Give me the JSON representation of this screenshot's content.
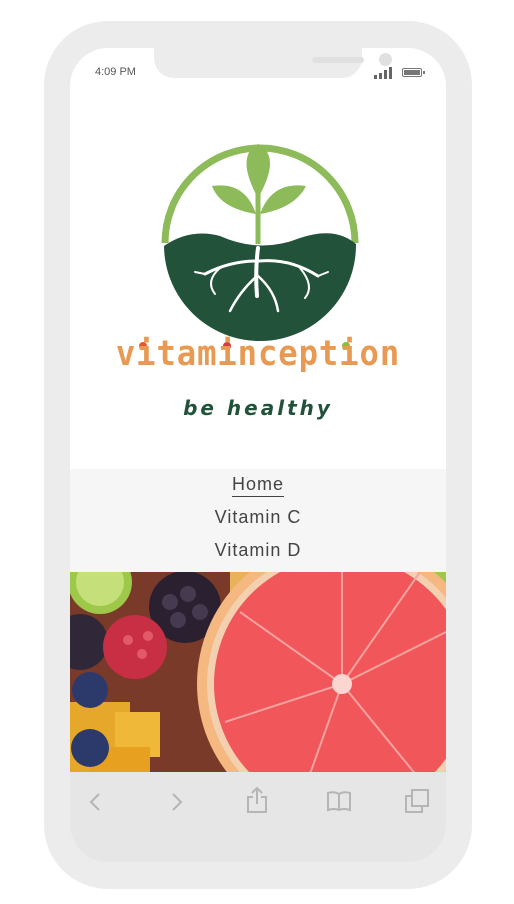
{
  "status_bar": {
    "time": "4:09 PM"
  },
  "brand": {
    "name": "vitaminception",
    "tagline": "be healthy"
  },
  "nav": {
    "items": [
      {
        "label": "Home",
        "active": true
      },
      {
        "label": "Vitamin C",
        "active": false
      },
      {
        "label": "Vitamin D",
        "active": false
      }
    ]
  },
  "toolbar": {
    "icons": [
      "back-icon",
      "forward-icon",
      "share-icon",
      "bookmarks-icon",
      "tabs-icon"
    ]
  },
  "colors": {
    "brand_orange": "#e89a52",
    "brand_green": "#23523a",
    "leaf_green": "#8dbb5a"
  }
}
